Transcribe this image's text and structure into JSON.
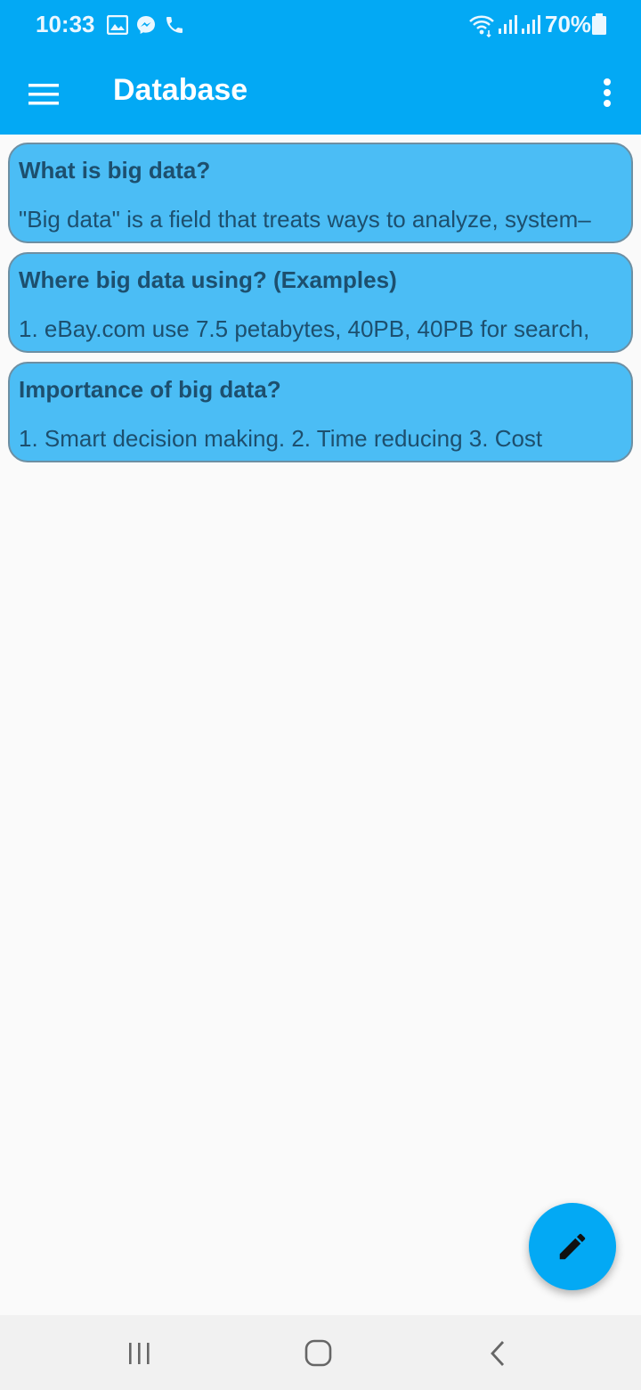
{
  "status_bar": {
    "time": "10:33",
    "battery": "70%",
    "icons": [
      "gallery-icon",
      "messenger-icon",
      "phone-icon",
      "wifi-icon",
      "signal-icon",
      "signal-icon",
      "battery-icon"
    ]
  },
  "app_bar": {
    "title": "Database",
    "left_icon": "menu-icon",
    "right_icon": "more-vert-icon"
  },
  "cards": [
    {
      "title": "What is big data?",
      "body": "\"Big data\" is a field that treats ways to analyze, system–"
    },
    {
      "title": "Where big data using? (Examples)",
      "body": "1. eBay.com use 7.5 petabytes, 40PB, 40PB for search,"
    },
    {
      "title": "Importance of big data?",
      "body": "1. Smart decision making. 2. Time reducing 3. Cost"
    }
  ],
  "fab": {
    "icon": "edit-icon"
  },
  "nav_bar": {
    "icons": [
      "recents-icon",
      "home-icon",
      "back-icon"
    ]
  },
  "colors": {
    "primary": "#03a9f4",
    "card": "#4bbdf5",
    "card_text": "#1d4f6e",
    "background": "#fafafa"
  }
}
